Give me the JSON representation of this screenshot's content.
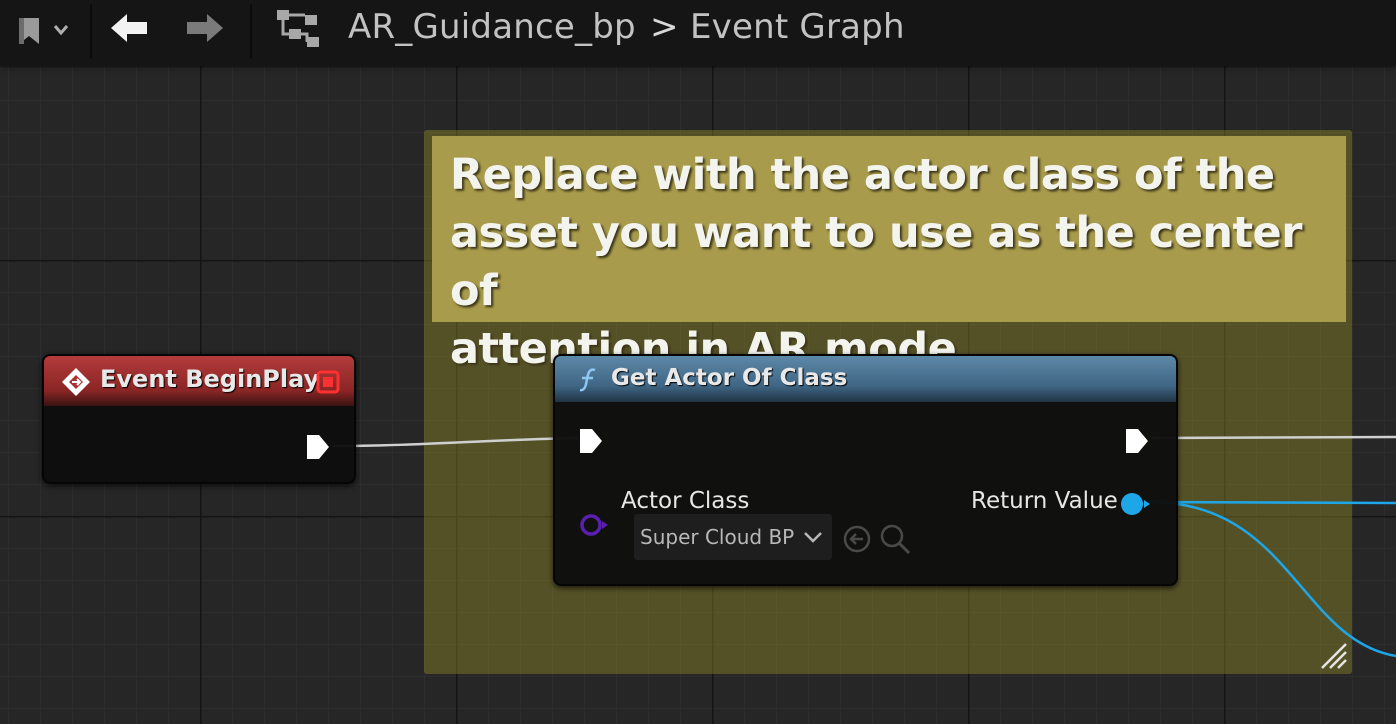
{
  "toolbar": {
    "bookmark_icon": "bookmark-icon",
    "back_icon": "arrow-left-icon",
    "forward_icon": "arrow-right-icon",
    "graph_icon": "blueprint-graph-icon"
  },
  "breadcrumb": {
    "asset": "AR_Guidance_bp",
    "separator": ">",
    "graph": "Event Graph"
  },
  "comment": {
    "text": "Replace with the actor class of the asset you want to use as the center of attention in AR mode",
    "line1": "Replace with the actor class of the",
    "line2": "asset you want to use as the center of",
    "line3": "attention in AR mode",
    "color": "#a89b4c"
  },
  "event_node": {
    "title": "Event BeginPlay",
    "header_color": "#a83232"
  },
  "function_node": {
    "title": "Get Actor Of Class",
    "header_color": "#4f7694",
    "input_pin_label": "Actor Class",
    "input_value": "Super Cloud BP",
    "output_pin_label": "Return Value"
  },
  "colors": {
    "exec_wire": "#cfcfcf",
    "object_wire": "#1ea7e8",
    "class_pin": "#5a1fb0"
  }
}
